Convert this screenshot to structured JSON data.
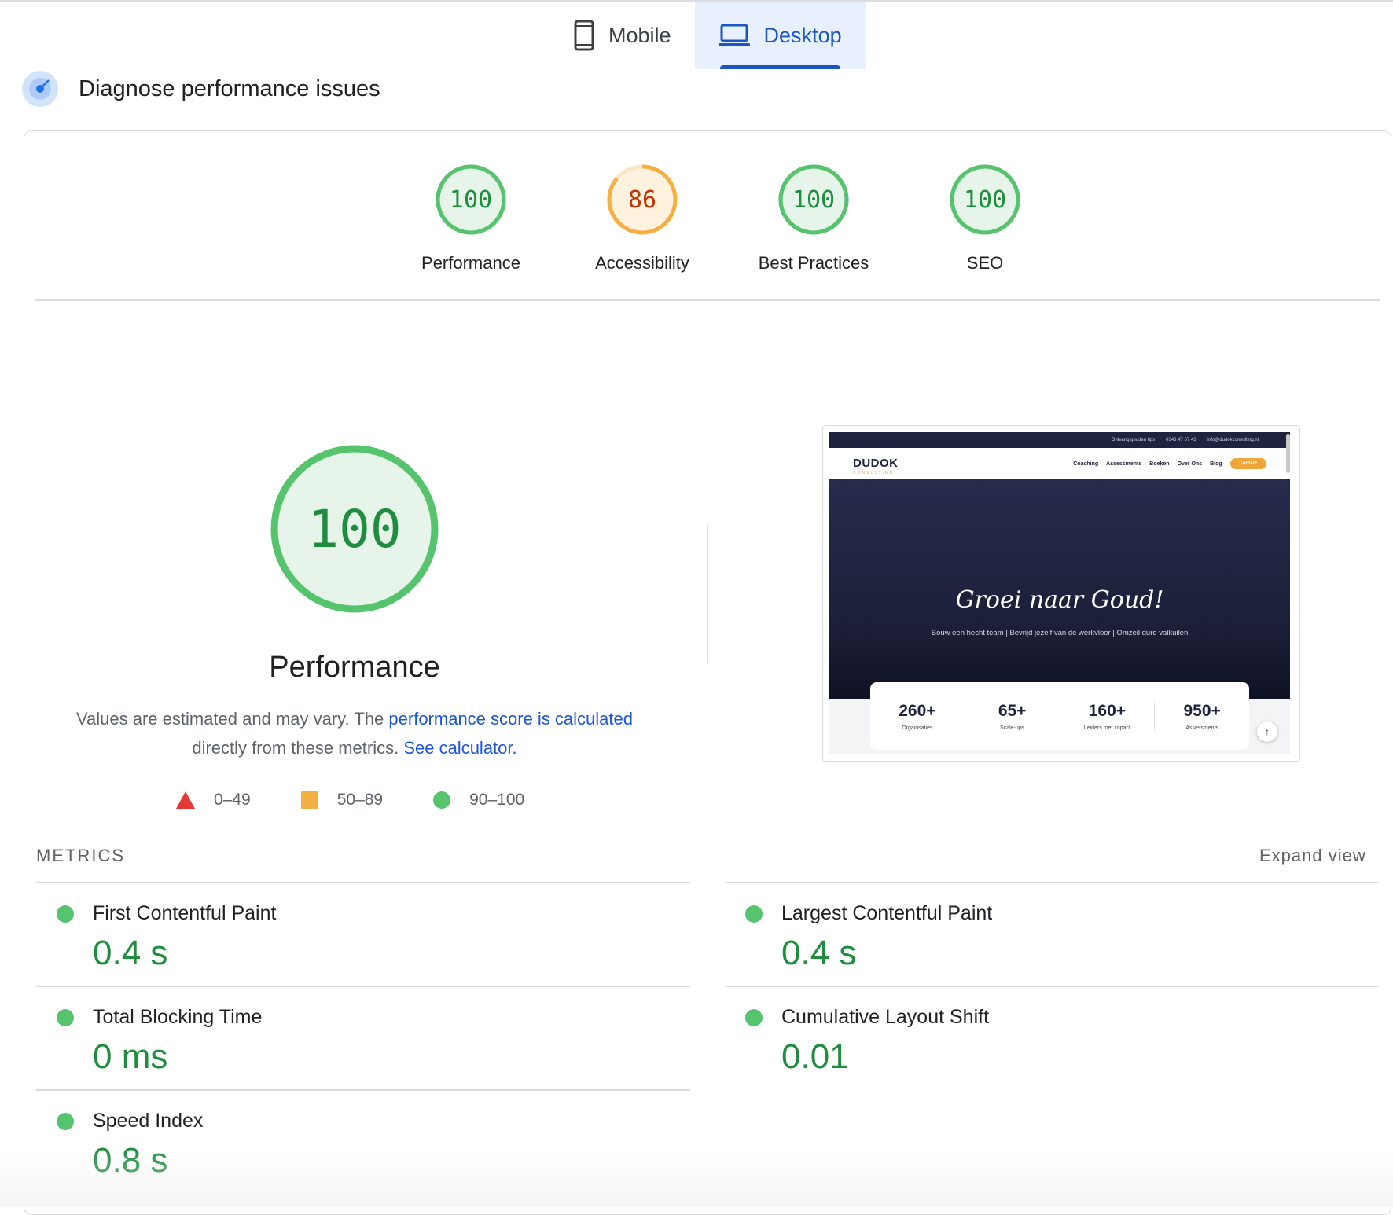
{
  "tabs": [
    {
      "label": "Mobile",
      "icon": "phone-icon",
      "active": false
    },
    {
      "label": "Desktop",
      "icon": "laptop-icon",
      "active": true
    }
  ],
  "section_title": "Diagnose performance issues",
  "categories": [
    {
      "label": "Performance",
      "score": 100,
      "color": "#0cce6b"
    },
    {
      "label": "Accessibility",
      "score": 86,
      "color": "#ffa400"
    },
    {
      "label": "Best Practices",
      "score": 100,
      "color": "#0cce6b"
    },
    {
      "label": "SEO",
      "score": 100,
      "color": "#0cce6b"
    }
  ],
  "performance": {
    "score": 100,
    "title": "Performance",
    "desc_prefix": "Values are estimated and may vary. The ",
    "desc_link1": "performance score is calculated",
    "desc_mid": "directly from these metrics. ",
    "desc_link2": "See calculator."
  },
  "legend": [
    {
      "shape": "triangle",
      "label": "0–49",
      "color": "#e53935"
    },
    {
      "shape": "square",
      "label": "50–89",
      "color": "#f4b042"
    },
    {
      "shape": "circle",
      "label": "90–100",
      "color": "#55c46d"
    }
  ],
  "screenshot": {
    "top_bar": [
      "Ontvang gouden tips",
      "0343 47 67 43",
      "info@dudokconsulting.nl"
    ],
    "logo": "DUDOK",
    "logo_sub": "CONSULTING",
    "menu": [
      "Coaching",
      "Assessments",
      "Boeken",
      "Over Ons",
      "Blog"
    ],
    "contact": "Contact",
    "headline": "Groei naar Goud!",
    "subline": "Bouw een hecht team | Bevrijd jezelf van de werkvloer | Omzeil dure valkuilen",
    "stats": [
      {
        "num": "260+",
        "label": "Organisaties"
      },
      {
        "num": "65+",
        "label": "Scale-ups"
      },
      {
        "num": "160+",
        "label": "Leiders met impact"
      },
      {
        "num": "950+",
        "label": "Assessments"
      }
    ],
    "up_arrow": "↑"
  },
  "metrics_header": "METRICS",
  "expand_label": "Expand view",
  "metrics": [
    {
      "name": "First Contentful Paint",
      "value": "0.4 s",
      "status": "good"
    },
    {
      "name": "Largest Contentful Paint",
      "value": "0.4 s",
      "status": "good"
    },
    {
      "name": "Total Blocking Time",
      "value": "0 ms",
      "status": "good"
    },
    {
      "name": "Cumulative Layout Shift",
      "value": "0.01",
      "status": "good"
    },
    {
      "name": "Speed Index",
      "value": "0.8 s",
      "status": "good"
    }
  ]
}
